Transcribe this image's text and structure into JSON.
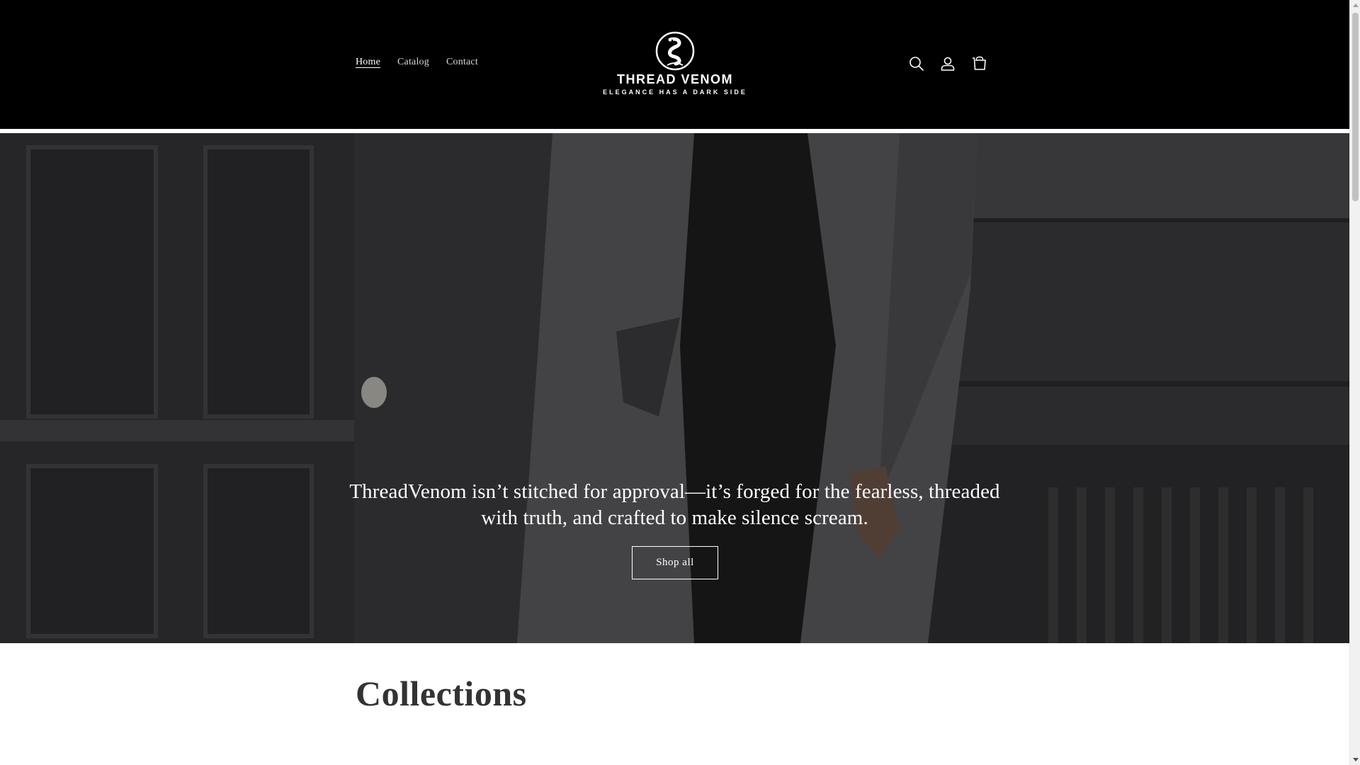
{
  "header": {
    "nav": [
      {
        "label": "Home",
        "active": true
      },
      {
        "label": "Catalog",
        "active": false
      },
      {
        "label": "Contact",
        "active": false
      }
    ],
    "logo": {
      "name": "THREAD VENOM",
      "tagline": "ELEGANCE HAS A DARK SIDE"
    },
    "icons": [
      "search-icon",
      "account-icon",
      "cart-icon"
    ]
  },
  "hero": {
    "text": "ThreadVenom isn’t stitched for approval—it’s forged for the fearless, threaded with truth, and crafted to make silence scream.",
    "button_label": "Shop all"
  },
  "collections": {
    "title": "Collections"
  },
  "colors": {
    "header_bg": "#000000",
    "text_on_dark": "#ffffff",
    "heading": "#333333"
  }
}
